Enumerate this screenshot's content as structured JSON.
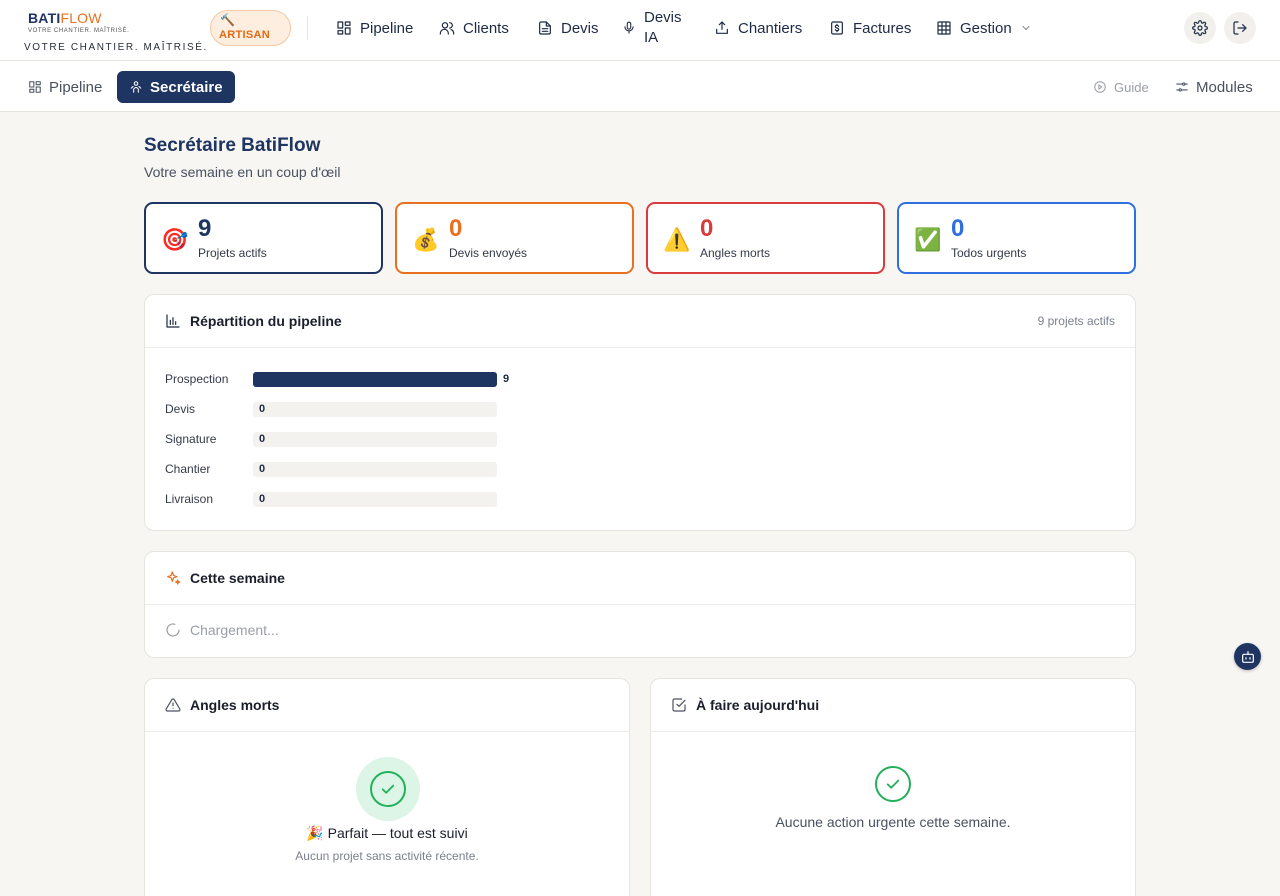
{
  "brand": {
    "name_part1": "BATI",
    "name_part2": "FLOW",
    "small_tagline": "VOTRE CHANTIER. MAÎTRISÉ.",
    "tagline": "VOTRE CHANTIER. MAÎTRISÉ.",
    "badge_label": "ARTISAN",
    "badge_icon": "hammer-icon"
  },
  "nav": {
    "items": [
      {
        "label": "Pipeline",
        "icon": "grid-icon"
      },
      {
        "label": "Clients",
        "icon": "users-icon"
      },
      {
        "label": "Devis",
        "icon": "document-icon"
      },
      {
        "label_line1": "Devis",
        "label_line2": "IA",
        "icon": "microphone-icon"
      },
      {
        "label": "Chantiers",
        "icon": "upload-icon"
      },
      {
        "label": "Factures",
        "icon": "dollar-file-icon"
      },
      {
        "label": "Gestion",
        "icon": "table-icon"
      }
    ]
  },
  "subnav": {
    "tabs": [
      {
        "label": "Pipeline",
        "icon": "grid-icon"
      },
      {
        "label": "Secrétaire",
        "icon": "secretary-icon"
      }
    ],
    "guide_label": "Guide",
    "modules_label": "Modules"
  },
  "header": {
    "title": "Secrétaire BatiFlow",
    "subtitle": "Votre semaine en un coup d'œil"
  },
  "stats": [
    {
      "emoji": "🎯",
      "value": "9",
      "label": "Projets actifs",
      "color": "#1e3461"
    },
    {
      "emoji": "💰",
      "value": "0",
      "label": "Devis envoyés",
      "color": "#e8701e"
    },
    {
      "emoji": "⚠️",
      "value": "0",
      "label": "Angles morts",
      "color": "#d93c3c"
    },
    {
      "emoji": "✅",
      "value": "0",
      "label": "Todos urgents",
      "color": "#2f6fe0"
    }
  ],
  "pipeline": {
    "title": "Répartition du pipeline",
    "summary": "9 projets actifs",
    "rows": [
      {
        "label": "Prospection",
        "value": 9,
        "display": "9"
      },
      {
        "label": "Devis",
        "value": 0,
        "display": "0"
      },
      {
        "label": "Signature",
        "value": 0,
        "display": "0"
      },
      {
        "label": "Chantier",
        "value": 0,
        "display": "0"
      },
      {
        "label": "Livraison",
        "value": 0,
        "display": "0"
      }
    ],
    "max": 9
  },
  "week": {
    "title": "Cette semaine",
    "loading": "Chargement..."
  },
  "blindspots": {
    "title": "Angles morts",
    "message": "Parfait — tout est suivi",
    "message_emoji": "🎉",
    "sub": "Aucun projet sans activité récente."
  },
  "today": {
    "title": "À faire aujourd'hui",
    "message": "Aucune action urgente cette semaine."
  },
  "colors": {
    "primary": "#1e3461",
    "accent": "#e8701e",
    "success": "#22b05a"
  }
}
